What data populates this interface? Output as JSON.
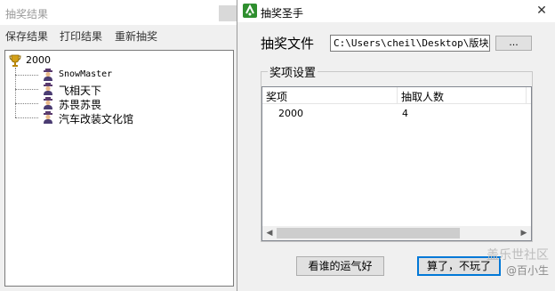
{
  "results_window": {
    "title": "抽奖结果",
    "menu": [
      "保存结果",
      "打印结果",
      "重新抽奖"
    ],
    "tree": {
      "root": "2000",
      "children": [
        "SnowMaster",
        "飞相天下",
        "苏畏苏畏",
        "汽车改装文化馆"
      ]
    }
  },
  "lottery_window": {
    "title": "抽奖圣手",
    "close_glyph": "✕",
    "file_label": "抽奖文件",
    "file_path": "C:\\Users\\cheil\\Desktop\\版块活",
    "browse_label": "...",
    "group_title": "奖项设置",
    "columns": [
      "奖项",
      "抽取人数"
    ],
    "rows": [
      {
        "prize": "2000",
        "count": "4"
      }
    ],
    "scroll_left": "◀",
    "scroll_right": "▶",
    "buttons": {
      "draw": "看谁的运气好",
      "cancel": "算了，不玩了"
    }
  },
  "watermark": {
    "line1": "盖乐世社区",
    "line2": "@百小生"
  }
}
